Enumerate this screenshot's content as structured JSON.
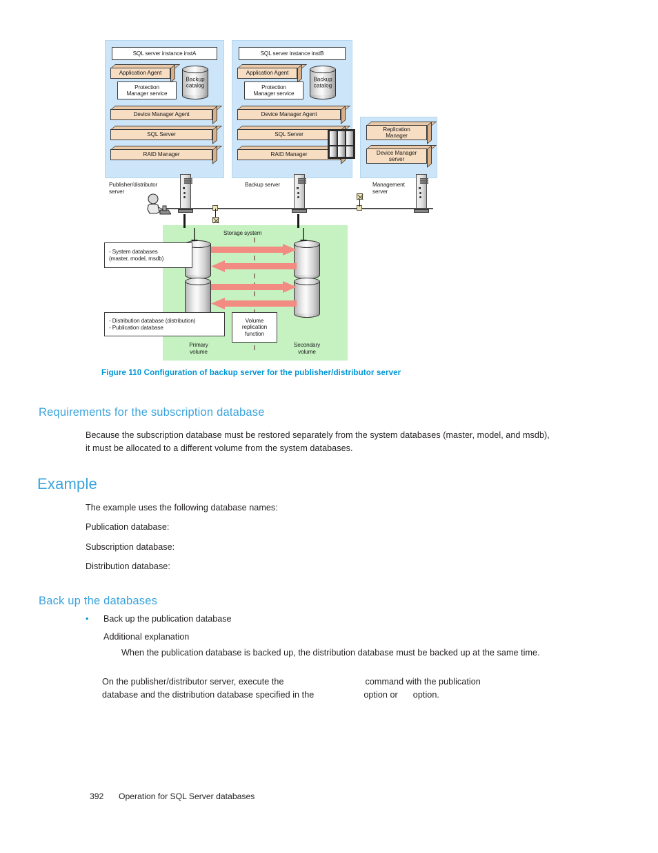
{
  "figure": {
    "caption": "Figure 110 Configuration of backup server for the publisher/distributor server",
    "panels": [
      {
        "id": "panel-a",
        "instance_title": "SQL server instance instA",
        "application_agent": "Application Agent",
        "protection_manager_service": "Protection\nManager service",
        "backup_catalog": "Backup\ncatalog",
        "device_manager_agent": "Device Manager Agent",
        "sql_server": "SQL Server",
        "raid_manager": "RAID Manager"
      },
      {
        "id": "panel-b",
        "instance_title": "SQL server instance instB",
        "application_agent": "Application Agent",
        "protection_manager_service": "Protection\nManager service",
        "backup_catalog": "Backup\ncatalog",
        "device_manager_agent": "Device Manager Agent",
        "sql_server": "SQL Server",
        "raid_manager": "RAID Manager"
      },
      {
        "id": "panel-c",
        "replication_manager": "Replication\nManager",
        "device_manager_server": "Device Manager\nserver"
      }
    ],
    "server_labels": {
      "publisher": "Publisher/distributor\nserver",
      "backup": "Backup server",
      "management": "Management\nserver"
    },
    "storage": {
      "title": "Storage system",
      "primary_volume": "Primary\nvolume",
      "secondary_volume": "Secondary\nvolume",
      "volume_replication_function": "Volume\nreplication\nfunction",
      "note_system_db": "- System databases\n(master, model, msdb)",
      "note_dist_db": "- Distribution database (distribution)\n- Publication database"
    }
  },
  "sections": {
    "requirements": {
      "heading": "Requirements for the subscription database",
      "body": "Because the subscription database must be restored separately from the system databases (master, model, and msdb), it must be allocated to a different volume from the system databases."
    },
    "example": {
      "heading": "Example",
      "intro": "The example uses the following database names:",
      "publication_label": "Publication database:",
      "subscription_label": "Subscription database:",
      "distribution_label": "Distribution database:"
    },
    "backup": {
      "heading": "Back up the databases",
      "bullet": "Back up the publication database",
      "additional_label": "Additional explanation",
      "additional_body": "When the publication database is backed up, the distribution database must be backed up at the same time.",
      "onthe_prefix": "On the publisher/distributor server, execute the",
      "onthe_mid": "command with the publication",
      "onthe_line2_prefix": "database and the distribution database specified in the",
      "onthe_line2_mid": "option or",
      "onthe_line2_suffix": "option."
    }
  },
  "footer": {
    "page_number": "392",
    "title": "Operation for SQL Server databases"
  },
  "colors": {
    "heading_blue": "#3aa3dd",
    "caption_blue": "#0096d6",
    "panel_blue": "#cde5f8",
    "slab_tan": "#f7ddc2",
    "storage_green": "#c6f2c2",
    "arrow_pink": "#f28b82",
    "body_text": "#231f20"
  }
}
